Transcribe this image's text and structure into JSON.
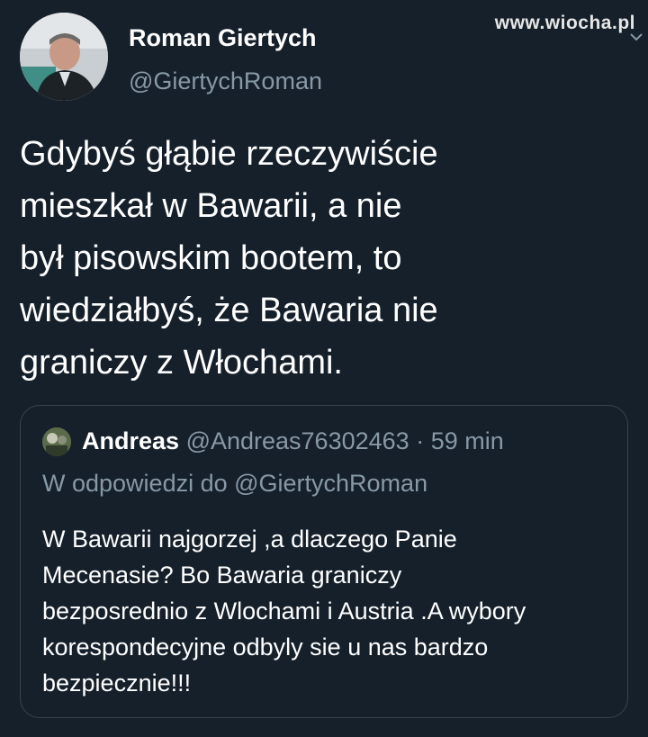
{
  "watermark": "www.wiocha.pl",
  "author": {
    "name": "Roman Giertych",
    "handle": "@GiertychRoman"
  },
  "tweet": {
    "lines": [
      "Gdybyś głąbie rzeczywiście",
      "mieszkał w Bawarii, a nie",
      "był pisowskim bootem, to",
      "wiedziałbyś, że Bawaria nie",
      "graniczy z Włochami."
    ]
  },
  "quoted": {
    "name": "Andreas",
    "handle": "@Andreas76302463",
    "separator": "·",
    "time": "59 min",
    "reply_to": "W odpowiedzi do @GiertychRoman",
    "lines": [
      "W Bawarii najgorzej ,a dlaczego Panie",
      "Mecenasie? Bo Bawaria graniczy",
      "bezposrednio z Wlochami i Austria .A wybory",
      "korespondecyjne odbyly sie u nas bardzo",
      "bezpiecznie!!!"
    ]
  },
  "icons": {
    "menu": "chevron-down-icon",
    "avatar": "profile-photo",
    "quoted_avatar": "profile-photo"
  },
  "colors": {
    "background": "#15202b",
    "primary_text": "#ffffff",
    "secondary_text": "#8899a6",
    "border": "#38444d"
  }
}
